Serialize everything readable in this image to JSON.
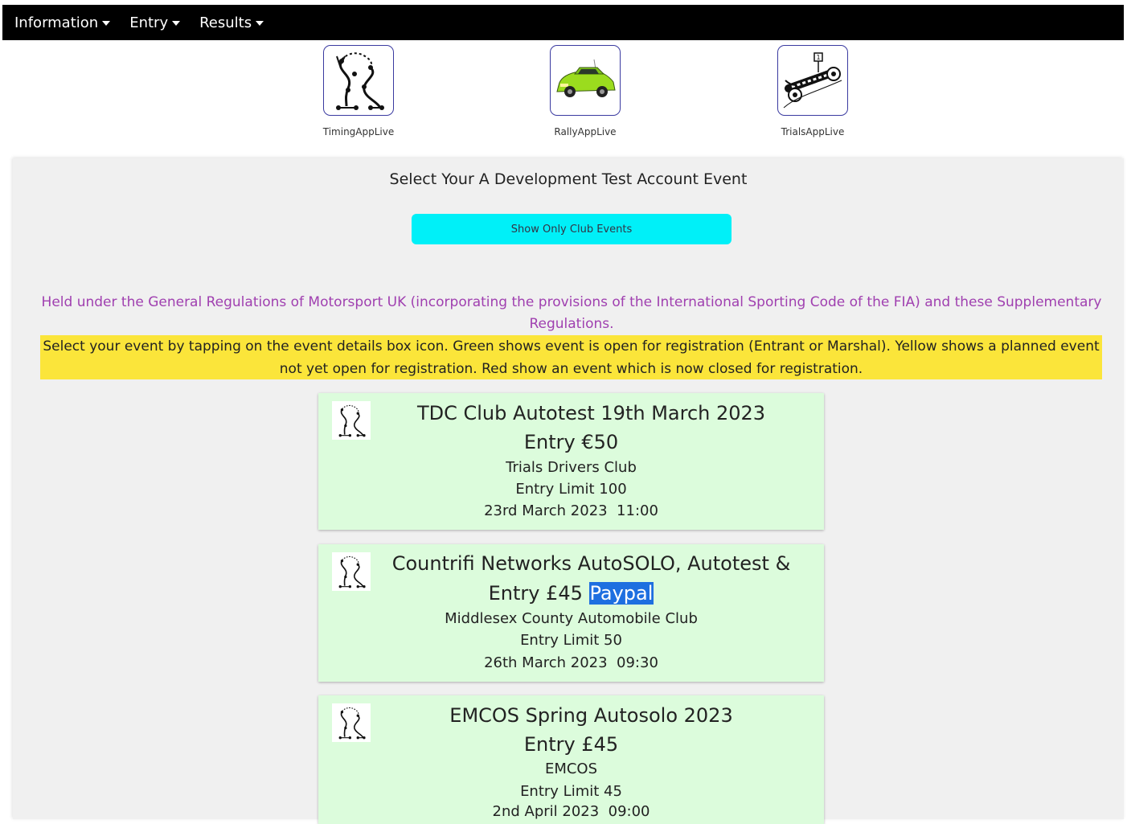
{
  "nav": {
    "items": [
      {
        "label": "Information"
      },
      {
        "label": "Entry"
      },
      {
        "label": "Results"
      }
    ]
  },
  "apps": [
    {
      "label": "TimingAppLive",
      "icon": "timing-course-icon"
    },
    {
      "label": "RallyAppLive",
      "icon": "green-car-icon"
    },
    {
      "label": "TrialsAppLive",
      "icon": "trials-map-icon"
    }
  ],
  "main": {
    "title": "Select Your A Development Test Account Event",
    "club_button": "Show Only Club Events",
    "regulations": "Held under the General Regulations of Motorsport UK (incorporating the provisions of the International Sporting Code of the FIA) and these Supplementary Regulations.",
    "notice": "Select your event by tapping on the event details box icon. Green shows event is open for registration (Entrant or Marshal). Yellow shows a planned event not yet open for registration. Red show an event which is now closed for registration."
  },
  "events": [
    {
      "title": "TDC Club Autotest 19th March 2023",
      "entry": "Entry €50",
      "entry_extra": "",
      "club": "Trials Drivers Club",
      "limit": "Entry Limit 100",
      "date": "23rd March 2023  11:00"
    },
    {
      "title": "Countrifi Networks AutoSOLO, Autotest &",
      "entry": "Entry £45",
      "entry_extra": "Paypal",
      "club": "Middlesex County Automobile Club",
      "limit": "Entry Limit 50",
      "date": "26th March 2023  09:30"
    },
    {
      "title": "EMCOS Spring Autosolo 2023",
      "entry": "Entry £45",
      "entry_extra": "",
      "club": "EMCOS",
      "limit": "Entry Limit 45",
      "date": "2nd April 2023  09:00"
    }
  ],
  "colors": {
    "navbar": "#000000",
    "club_button": "#00f0f8",
    "regulations_text": "#a040b0",
    "notice_bg": "#fbe53a",
    "card_open": "#dcfcdc"
  }
}
